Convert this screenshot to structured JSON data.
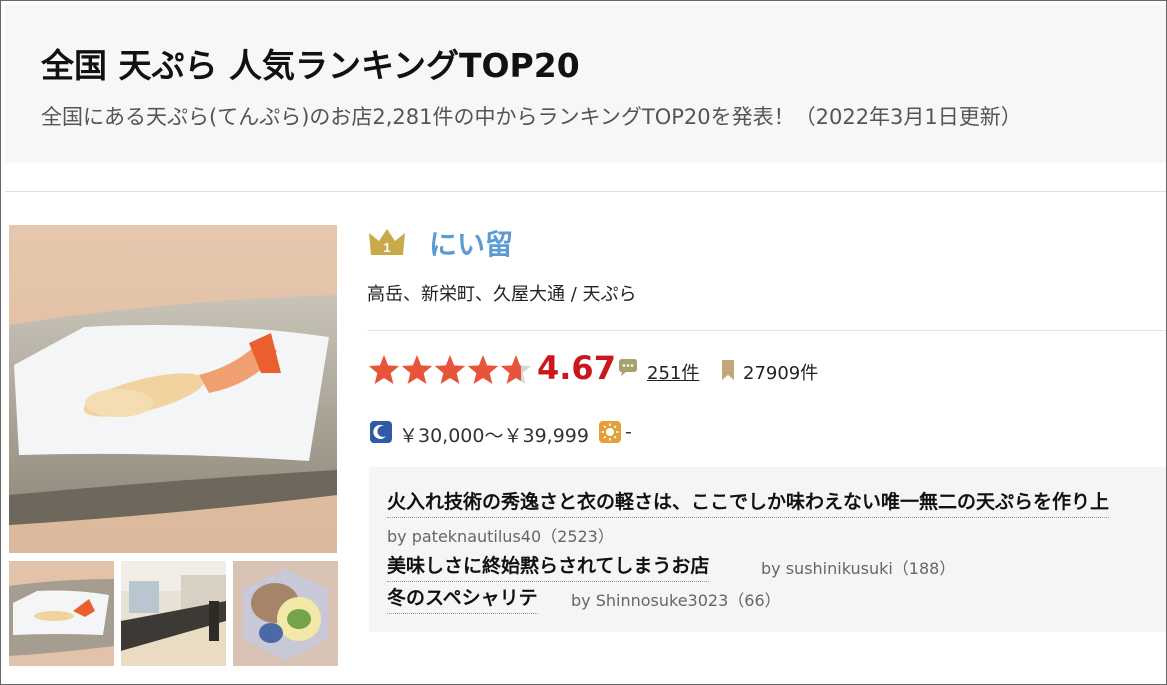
{
  "header": {
    "title": "全国 天ぷら 人気ランキングTOP20",
    "subtitle": "全国にある天ぷら(てんぷら)のお店2,281件の中からランキングTOP20を発表！（2022年3月1日更新）"
  },
  "restaurant": {
    "rank": "1",
    "name": "にい留",
    "area_genre": "高岳、新栄町、久屋大通 / 天ぷら",
    "rating": 4.67,
    "rating_text": "4.67",
    "review_count": "251件",
    "bookmark_count": "27909件",
    "dinner_price": "￥30,000～￥39,999",
    "lunch_price": "-",
    "photos": [
      "shrimp-tempura-photo",
      "counter-interior-photo",
      "clam-dish-photo"
    ]
  },
  "reviews": [
    {
      "title": "火入れ技術の秀逸さと衣の軽さは、ここでしか味わえない唯一無二の天ぷらを作り上",
      "by": "by pateknautilus40（2523）"
    },
    {
      "title": "美味しさに終始黙らされてしまうお店",
      "by": "by sushinikusuki（188）"
    },
    {
      "title": "冬のスペシャリテ",
      "by": "by Shinnosuke3023（66）"
    }
  ],
  "colors": {
    "accent_link": "#5b9bd1",
    "score": "#c9171e",
    "star": "#e8543a",
    "gold_badge": "#c9a94a",
    "header_bg": "#f7f7f5"
  },
  "icons": {
    "rank": "crown-badge-icon",
    "review": "speech-bubble-icon",
    "bookmark": "bookmark-icon",
    "dinner": "moon-icon",
    "lunch": "sun-icon"
  }
}
